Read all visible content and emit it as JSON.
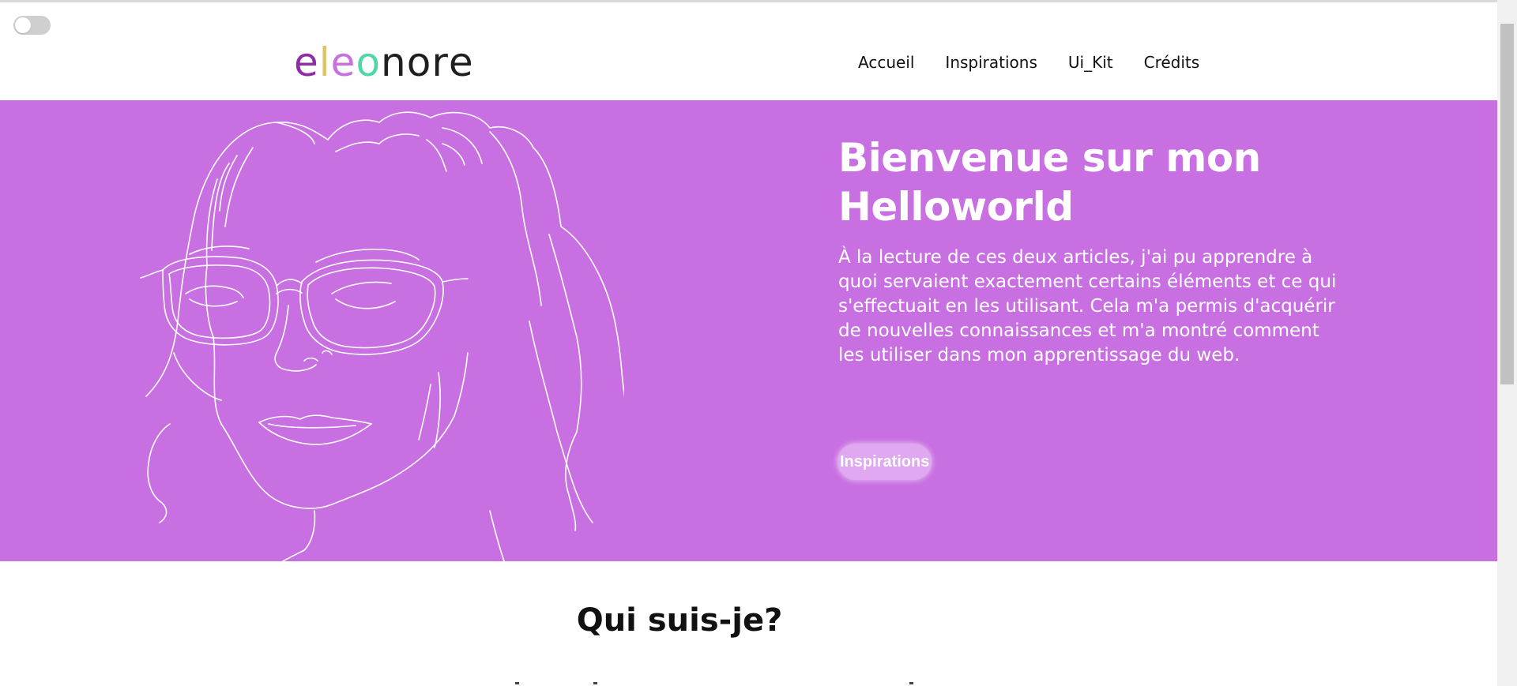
{
  "logo": {
    "letters": [
      "e",
      "l",
      "e",
      "o",
      "n",
      "o",
      "r",
      "e"
    ],
    "letter_colors": [
      "#8e2da6",
      "#e2c16c",
      "#c86fe2",
      "#4fd8a5",
      "#1f1f1f",
      "#1f1f1f",
      "#1f1f1f",
      "#1f1f1f"
    ]
  },
  "nav": {
    "items": [
      {
        "label": "Accueil"
      },
      {
        "label": "Inspirations"
      },
      {
        "label": "Ui_Kit"
      },
      {
        "label": "Crédits"
      }
    ]
  },
  "hero": {
    "title": "Bienvenue sur mon Helloworld",
    "text": "À la lecture de ces deux articles, j'ai pu apprendre à quoi servaient exactement certains éléments et ce qui s'effectuait en les utilisant. Cela m'a permis d'acquérir de nouvelles connaissances et m'a montré comment les utiliser dans mon apprentissage du web.",
    "button_label": "Inspirations",
    "background_color": "#c86fe2",
    "button_color": "#dfa8f0"
  },
  "about": {
    "title": "Qui suis-je?"
  },
  "theme_toggle": {
    "state": "off",
    "icon": "toggle-switch-icon"
  }
}
